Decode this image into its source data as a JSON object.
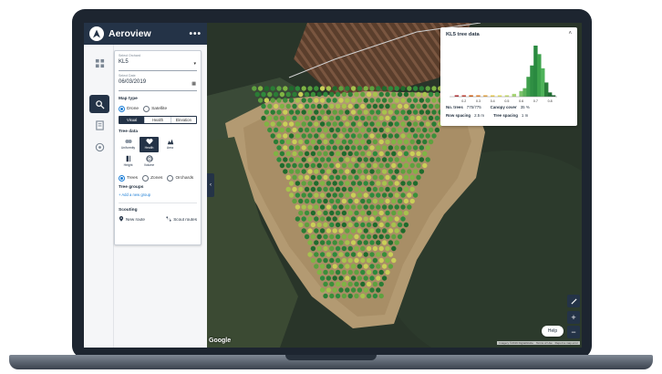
{
  "app": {
    "title": "Aeroview",
    "more_icon": "more-dots-icon"
  },
  "rail": {
    "items": [
      {
        "icon": "dashboard-icon",
        "active": false
      },
      {
        "icon": "map-search-icon",
        "active": true
      },
      {
        "icon": "report-icon",
        "active": false
      },
      {
        "icon": "target-icon",
        "active": false
      }
    ]
  },
  "panel": {
    "orchard": {
      "label": "Select Orchard",
      "value": "KL5"
    },
    "date": {
      "label": "Select Date",
      "value": "06/03/2019"
    },
    "map_type": {
      "title": "Map type",
      "options": [
        "Drone",
        "Satellite"
      ],
      "selected": "Drone",
      "layers": [
        "Visual",
        "Health",
        "Elevation"
      ],
      "active_layer": "Visual"
    },
    "tree_data": {
      "title": "Tree data",
      "metrics": [
        {
          "label": "Uniformity",
          "icon": "uniformity-icon"
        },
        {
          "label": "Health",
          "icon": "health-icon"
        },
        {
          "label": "Area",
          "icon": "area-icon"
        },
        {
          "label": "Height",
          "icon": "height-icon"
        },
        {
          "label": "Volume",
          "icon": "volume-icon"
        }
      ],
      "active_metric": "Health",
      "views": [
        "Trees",
        "Zones",
        "Orchards"
      ],
      "selected_view": "Trees"
    },
    "tree_groups": {
      "title": "Tree groups",
      "add_link": "+ Add a new group"
    },
    "scouting": {
      "title": "Scouting",
      "new_route": "New route",
      "scout_routes": "Scout routes"
    }
  },
  "tree_card": {
    "title": "KL5 tree data",
    "stats": [
      {
        "key": "No. trees",
        "value": "775/775"
      },
      {
        "key": "Canopy cover",
        "value": "35 %"
      },
      {
        "key": "Row spacing",
        "value": "2.5 m"
      },
      {
        "key": "Tree spacing",
        "value": "1 m"
      }
    ]
  },
  "chart_data": {
    "type": "bar",
    "categories": [
      "0.2",
      "0.3",
      "0.4",
      "0.5",
      "0.6",
      "0.7",
      "0.8"
    ],
    "x": [
      0.15,
      0.2,
      0.25,
      0.3,
      0.35,
      0.4,
      0.45,
      0.5,
      0.55,
      0.6,
      0.625,
      0.65,
      0.675,
      0.7,
      0.725,
      0.75,
      0.775,
      0.8,
      0.825
    ],
    "values": [
      1,
      1,
      1,
      1,
      1,
      1,
      1,
      1,
      2,
      4,
      6,
      14,
      22,
      36,
      30,
      20,
      10,
      3,
      1
    ],
    "colors": [
      "#b1262b",
      "#c0392b",
      "#d35400",
      "#e67e22",
      "#e8a33a",
      "#eccc4a",
      "#e6e35a",
      "#c7e06b",
      "#a7d676",
      "#7cc36b",
      "#5eb35c",
      "#3e9f4c",
      "#2f8f44",
      "#2a8a40",
      "#3da24c",
      "#4fb35a",
      "#2a7d3a",
      "#1e6e32",
      "#145c27"
    ],
    "xlim": [
      0.1,
      0.85
    ],
    "grid": false,
    "legend": "none"
  },
  "map": {
    "help": "Help",
    "google": "Google",
    "attribution": [
      "Imagery ©2019 DigitalGlobe",
      "Terms of Use",
      "Report a map error"
    ],
    "controls": [
      {
        "icon": "pencil-icon"
      },
      {
        "icon": "zoom-in-icon",
        "glyph": "+"
      },
      {
        "icon": "zoom-out-icon",
        "glyph": "−"
      }
    ]
  }
}
